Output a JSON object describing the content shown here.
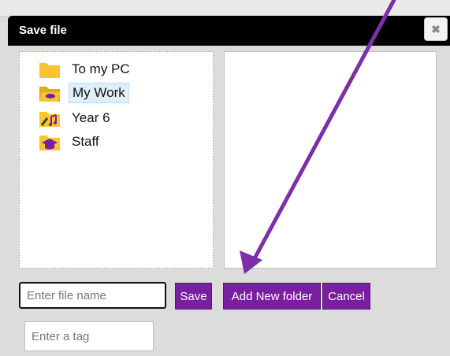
{
  "dialog": {
    "title": "Save file",
    "close_icon": "close-icon"
  },
  "folders": [
    {
      "label": "To my PC",
      "icon": "folder-icon"
    },
    {
      "label": "My Work",
      "icon": "open-folder-icon",
      "selected": true
    },
    {
      "label": "Year 6",
      "icon": "music-folder-icon"
    },
    {
      "label": "Staff",
      "icon": "graduation-cap-folder-icon"
    }
  ],
  "form": {
    "file_placeholder": "Enter file name",
    "tag_placeholder": "Enter a tag",
    "save_label": "Save",
    "add_folder_label": "Add New folder",
    "cancel_label": "Cancel"
  },
  "colors": {
    "accent": "#7b1fa2",
    "folder_yellow": "#f7c52e",
    "annotation_arrow": "#7b2fa8"
  }
}
